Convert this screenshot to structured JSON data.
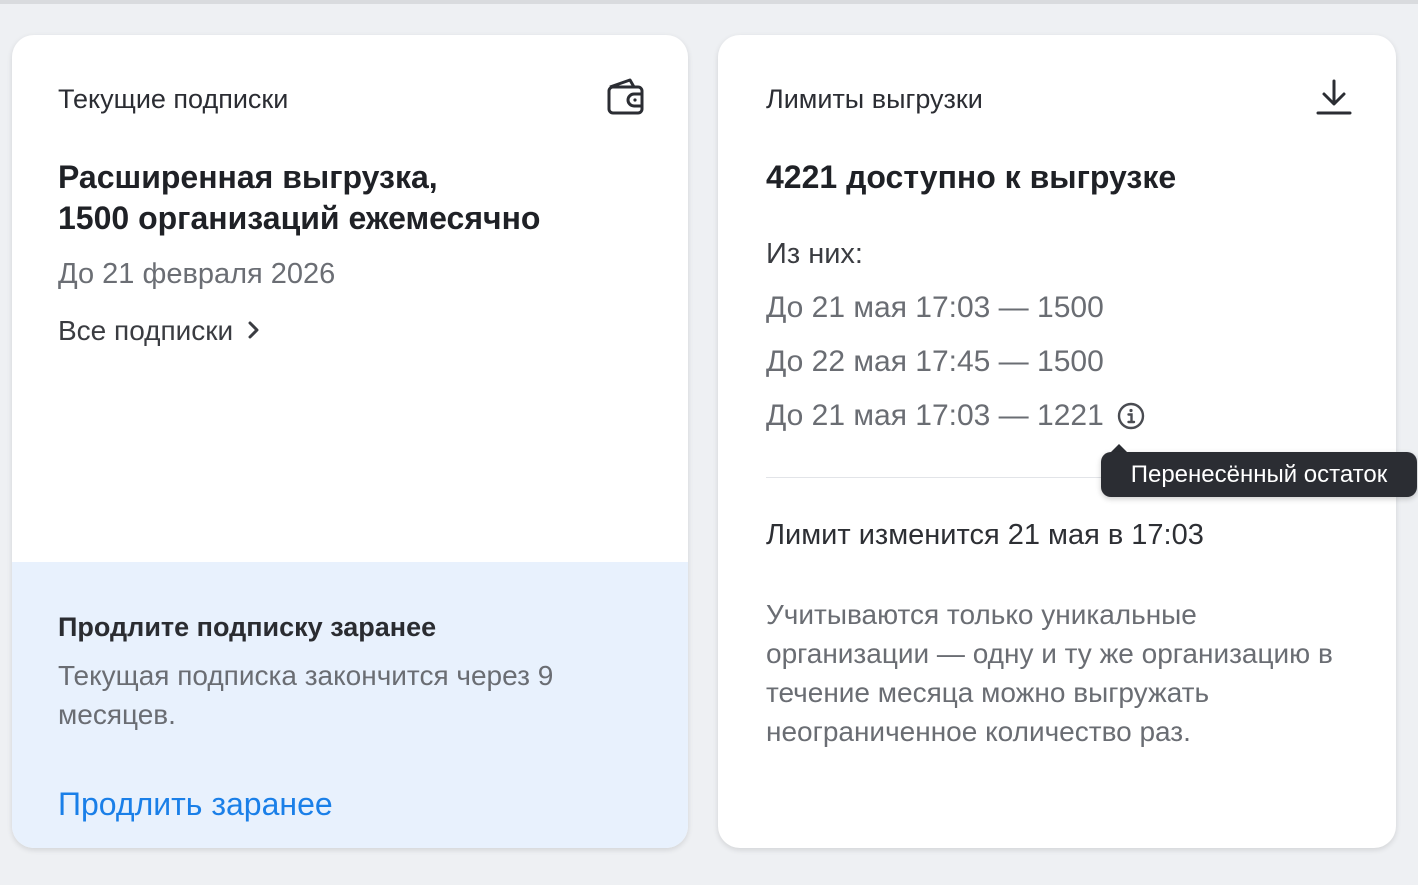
{
  "subscriptions": {
    "title": "Текущие подписки",
    "icon": "wallet-icon",
    "plan_line1": "Расширенная выгрузка,",
    "plan_line2": "1500 организаций ежемесячно",
    "valid_until": "До 21 февраля 2026",
    "all_link": "Все подписки",
    "all_link_icon": "chevron-right-icon",
    "promo": {
      "title": "Продлите подписку заранее",
      "text": "Текущая подписка закончится через 9 месяцев.",
      "link": "Продлить заранее",
      "background": "#e8f1fd",
      "link_color": "#1a7fe8"
    }
  },
  "limits": {
    "title": "Лимиты выгрузки",
    "icon": "download-icon",
    "available": "4221 доступно к выгрузке",
    "of_them": "Из них:",
    "rows": [
      {
        "text": "До 21 мая 17:03 — 1500"
      },
      {
        "text": "До 22 мая 17:45 — 1500"
      },
      {
        "text": "До 21 мая 17:03 — 1221",
        "icon": "info-icon"
      }
    ],
    "tooltip": "Перенесённый остаток",
    "change": "Лимит изменится 21 мая в 17:03",
    "note": "Учитываются только уникальные организации — одну и ту же организацию в течение месяца можно выгружать неограниченное количество раз."
  }
}
